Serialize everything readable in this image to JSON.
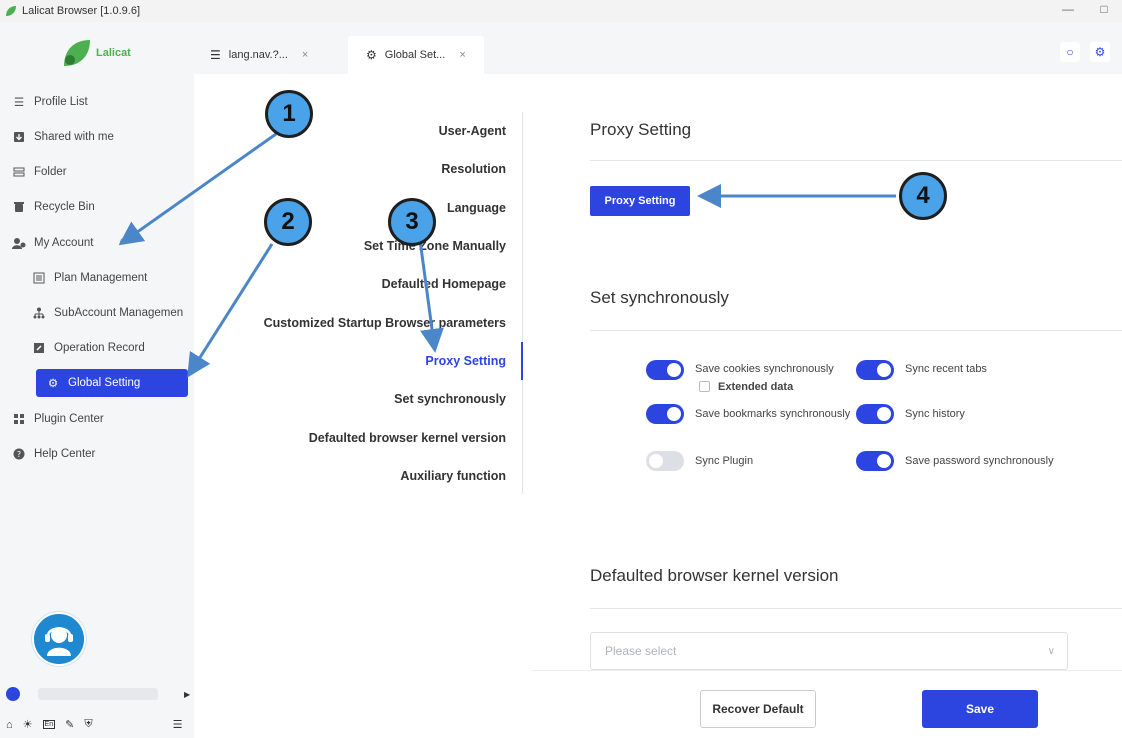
{
  "window": {
    "title": "Lalicat Browser  [1.0.9.6]",
    "minimize": "—",
    "maximize": "□"
  },
  "sidebar": {
    "logo_text": "Lalicat",
    "items": [
      {
        "label": "Profile List",
        "icon": "list-icon"
      },
      {
        "label": "Shared with me",
        "icon": "shared-icon"
      },
      {
        "label": "Folder",
        "icon": "folder-icon"
      },
      {
        "label": "Recycle Bin",
        "icon": "recycle-bin-icon"
      },
      {
        "label": "My Account",
        "icon": "account-icon"
      },
      {
        "label": "Plan Management",
        "icon": "plan-icon"
      },
      {
        "label": "SubAccount Managemen",
        "icon": "subaccount-icon"
      },
      {
        "label": "Operation Record",
        "icon": "record-icon"
      },
      {
        "label": "Global Setting",
        "icon": "gear-icon"
      },
      {
        "label": "Plugin Center",
        "icon": "plugin-icon"
      },
      {
        "label": "Help Center",
        "icon": "help-icon"
      }
    ],
    "collapse_glyph": "^"
  },
  "tabs": [
    {
      "label": "lang.nav.?...",
      "close": "×"
    },
    {
      "label": "Global Set...",
      "close": "×"
    }
  ],
  "subnav": [
    "User-Agent",
    "Resolution",
    "Language",
    "Set Time Zone Manually",
    "Defaulted Homepage",
    "Customized Startup Browser parameters",
    "Proxy Setting",
    "Set synchronously",
    "Defaulted browser kernel version",
    "Auxiliary function"
  ],
  "proxy": {
    "title": "Proxy Setting",
    "button": "Proxy Setting"
  },
  "sync": {
    "title": "Set synchronously",
    "toggles": [
      {
        "label": "Save cookies synchronously",
        "on": true
      },
      {
        "label": "Sync recent tabs",
        "on": true
      },
      {
        "label": "Save bookmarks synchronously",
        "on": true
      },
      {
        "label": "Sync history",
        "on": true
      },
      {
        "label": "Sync Plugin",
        "on": false
      },
      {
        "label": "Save password synchronously",
        "on": true
      }
    ],
    "extended_data": "Extended data"
  },
  "kernel": {
    "title": "Defaulted browser kernel version",
    "placeholder": "Please select"
  },
  "footer": {
    "recover": "Recover Default",
    "save": "Save"
  },
  "annotations": [
    "1",
    "2",
    "3",
    "4"
  ],
  "colors": {
    "accent": "#2d45e0",
    "badge": "#4aa3e8",
    "arrow": "#4a86c8"
  }
}
